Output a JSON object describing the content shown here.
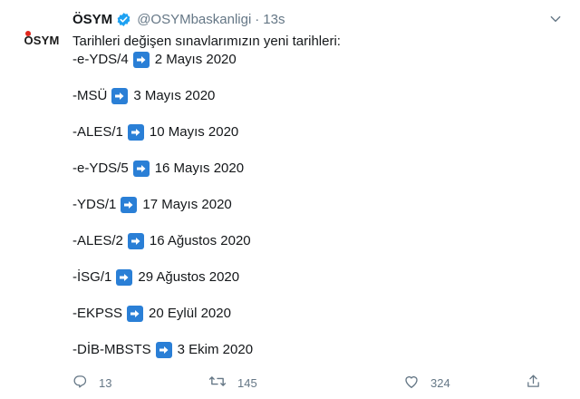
{
  "author": {
    "name": "ÖSYM",
    "handle": "@OSYMbaskanligi",
    "separator": "·",
    "time": "13s",
    "logo_text": "ÖSYM"
  },
  "tweet": {
    "intro": "Tarihleri değişen sınavlarımızın yeni tarihleri:",
    "items": [
      {
        "exam": "-e-YDS/4",
        "date": "2 Mayıs 2020"
      },
      {
        "exam": "-MSÜ",
        "date": "3 Mayıs 2020"
      },
      {
        "exam": "-ALES/1",
        "date": "10 Mayıs 2020"
      },
      {
        "exam": "-e-YDS/5",
        "date": "16 Mayıs 2020"
      },
      {
        "exam": "-YDS/1",
        "date": "17 Mayıs 2020"
      },
      {
        "exam": "-ALES/2",
        "date": "16 Ağustos 2020"
      },
      {
        "exam": "-İSG/1",
        "date": "29 Ağustos 2020"
      },
      {
        "exam": "-EKPSS",
        "date": "20 Eylül 2020"
      },
      {
        "exam": "-DİB-MBSTS",
        "date": "3 Ekim 2020"
      }
    ]
  },
  "actions": {
    "replies": "13",
    "retweets": "145",
    "likes": "324"
  },
  "icons": {
    "verified": "verified-badge-icon",
    "arrow": "right-arrow-emoji-icon",
    "more": "chevron-down-icon",
    "reply": "reply-icon",
    "retweet": "retweet-icon",
    "like": "heart-icon",
    "share": "share-icon"
  },
  "colors": {
    "verified": "#1da1f2",
    "arrow_bg": "#2a7fd6",
    "muted": "#657786",
    "text": "#14171a",
    "logo_dot": "#e1261c"
  }
}
